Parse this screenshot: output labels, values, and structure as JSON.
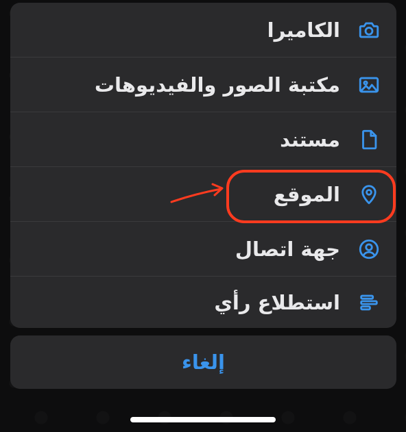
{
  "menu": {
    "items": [
      {
        "label": "الكاميرا",
        "icon": "camera-icon"
      },
      {
        "label": "مكتبة الصور والفيديوهات",
        "icon": "photo-icon"
      },
      {
        "label": "مستند",
        "icon": "document-icon"
      },
      {
        "label": "الموقع",
        "icon": "location-pin-icon"
      },
      {
        "label": "جهة اتصال",
        "icon": "contact-icon"
      },
      {
        "label": "استطلاع رأي",
        "icon": "poll-icon"
      }
    ]
  },
  "cancel": {
    "label": "إلغاء"
  },
  "colors": {
    "accent": "#3a94ec",
    "sheet": "#2a2a2c",
    "highlight": "#ff3b1f"
  }
}
